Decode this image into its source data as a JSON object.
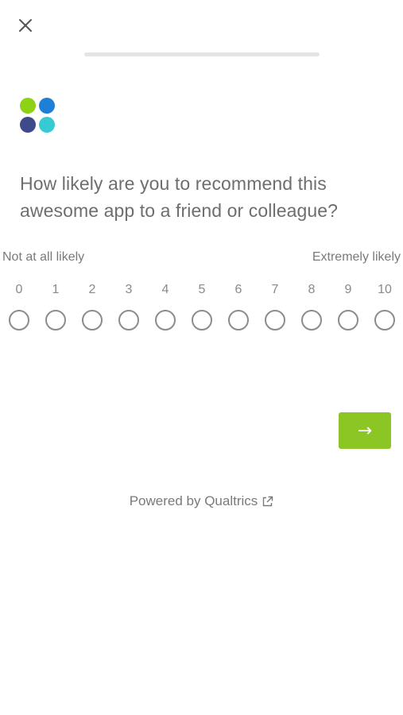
{
  "survey": {
    "progress_percent": 0,
    "question": "How likely are you to recommend this awesome app to a friend or colleague?",
    "anchor_low": "Not at all likely",
    "anchor_high": "Extremely likely",
    "scale_labels": [
      "0",
      "1",
      "2",
      "3",
      "4",
      "5",
      "6",
      "7",
      "8",
      "9",
      "10"
    ],
    "selected": null,
    "next_label": "→"
  },
  "footer": {
    "powered_by": "Powered by Qualtrics"
  },
  "icons": {
    "close": "close-icon",
    "next": "arrow-right-icon",
    "external": "external-link-icon",
    "logo": "four-dot-logo"
  },
  "colors": {
    "accent": "#8bc625",
    "logo_dots": [
      "#8fd114",
      "#1e7fd6",
      "#3e4b8a",
      "#36cbd3"
    ]
  }
}
